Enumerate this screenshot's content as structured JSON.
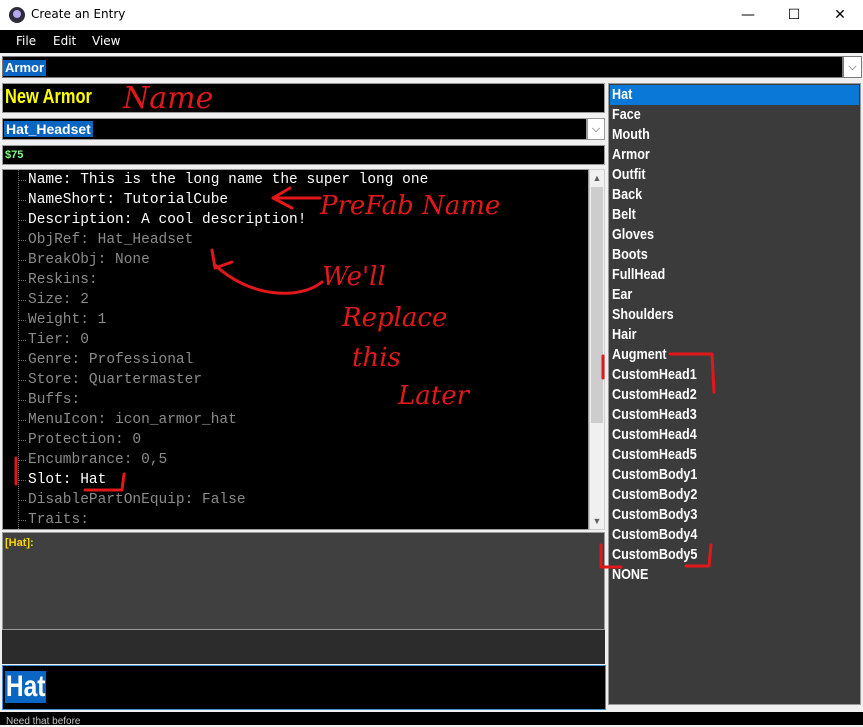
{
  "window": {
    "title": "Create an Entry",
    "minimize_glyph": "—",
    "maximize_glyph": "☐",
    "close_glyph": "✕"
  },
  "menu": [
    "File",
    "Edit",
    "View"
  ],
  "category": {
    "value": "Armor",
    "arrow_glyph": "⌵"
  },
  "entry": {
    "name": "New Armor",
    "prefab": "Hat_Headset",
    "price": "$75"
  },
  "properties": [
    {
      "text": "Name: This is the long name the super long one",
      "enabled": true
    },
    {
      "text": "NameShort: TutorialCube",
      "enabled": true
    },
    {
      "text": "Description: A cool description!",
      "enabled": true
    },
    {
      "text": "ObjRef: Hat_Headset",
      "enabled": false
    },
    {
      "text": "BreakObj: None",
      "enabled": false
    },
    {
      "text": "Reskins:",
      "enabled": false
    },
    {
      "text": "Size: 2",
      "enabled": false
    },
    {
      "text": "Weight: 1",
      "enabled": false
    },
    {
      "text": "Tier: 0",
      "enabled": false
    },
    {
      "text": "Genre: Professional",
      "enabled": false
    },
    {
      "text": "Store: Quartermaster",
      "enabled": false
    },
    {
      "text": "Buffs:",
      "enabled": false
    },
    {
      "text": "MenuIcon: icon_armor_hat",
      "enabled": false
    },
    {
      "text": "Protection: 0",
      "enabled": false
    },
    {
      "text": "Encumbrance: 0,5",
      "enabled": false
    },
    {
      "text": "Slot: Hat",
      "enabled": true
    },
    {
      "text": "DisablePartOnEquip: False",
      "enabled": false
    },
    {
      "text": "Traits:",
      "enabled": false
    }
  ],
  "detail": {
    "tag": "[Hat]:"
  },
  "value_editor": {
    "value": "Hat"
  },
  "slots": [
    "Hat",
    "Face",
    "Mouth",
    "Armor",
    "Outfit",
    "Back",
    "Belt",
    "Gloves",
    "Boots",
    "FullHead",
    "Ear",
    "Shoulders",
    "Hair",
    "Augment",
    "CustomHead1",
    "CustomHead2",
    "CustomHead3",
    "CustomHead4",
    "CustomHead5",
    "CustomBody1",
    "CustomBody2",
    "CustomBody3",
    "CustomBody4",
    "CustomBody5",
    "NONE"
  ],
  "selected_slot": "Hat",
  "status": {
    "text": "Need that before"
  },
  "annotations": {
    "name_note": "Name",
    "prefab_note": "PreFab Name",
    "replace_note": [
      "We'll",
      "Replace",
      "this",
      "Later"
    ]
  },
  "colors": {
    "name_text": "#ffff00",
    "price_text": "#7fff7f",
    "selection": "#0a78d7",
    "annotation": "#e0181a"
  }
}
